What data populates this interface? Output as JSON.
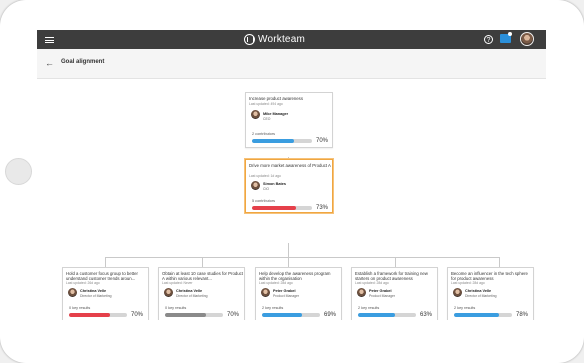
{
  "app": {
    "name": "Workteam"
  },
  "topbar": {
    "help_glyph": "?"
  },
  "page": {
    "title": "Goal alignment",
    "back_glyph": "←"
  },
  "icons": [
    "menu-icon",
    "workteam-logo-icon",
    "help-icon",
    "notifications-icon",
    "user-avatar",
    "back-arrow-icon"
  ],
  "colors": {
    "topbar": "#3d3d3d",
    "blue": "#3a9de0",
    "red": "#e5404a",
    "gray": "#8a8a8a",
    "selected_border": "#f0a640"
  },
  "goals": {
    "root": {
      "title": "Increase product awareness",
      "updated": "Last updated: 494 ago",
      "owner": "Mike Manager",
      "role": "CEO",
      "sub": "2 contributors",
      "progress": 70,
      "pct": "70%",
      "color": "#3a9de0"
    },
    "mid": {
      "title": "Drive more market awareness of Product A",
      "updated": "Last updated: 1d ago",
      "owner": "Simon Bates",
      "role": "CIO",
      "sub": "5 contributors",
      "progress": 73,
      "pct": "73%",
      "color": "#e5404a"
    },
    "children": [
      {
        "title": "Hold a customer focus group to better understand customer trends aroun...",
        "updated": "Last updated: 26d ago",
        "owner": "Christina Velle",
        "role": "Director of Marketing",
        "sub": "0 key results",
        "progress": 70,
        "pct": "70%",
        "color": "#e5404a"
      },
      {
        "title": "Obtain at least 10 case studies for Product A within various relevant...",
        "updated": "Last updated: Never",
        "owner": "Christina Velle",
        "role": "Director of Marketing",
        "sub": "0 key results",
        "progress": 70,
        "pct": "70%",
        "color": "#8a8a8a"
      },
      {
        "title": "Help develop the awareness program within the organisation",
        "updated": "Last updated: 28d ago",
        "owner": "Peter Grabel",
        "role": "Product Manager",
        "sub": "2 key results",
        "progress": 69,
        "pct": "69%",
        "color": "#3a9de0"
      },
      {
        "title": "Establish a framework for training new starters on product awareness",
        "updated": "Last updated: 28d ago",
        "owner": "Peter Grabel",
        "role": "Product Manager",
        "sub": "2 key results",
        "progress": 63,
        "pct": "63%",
        "color": "#3a9de0"
      },
      {
        "title": "Become an influencer in the tech sphere for product awareness",
        "updated": "Last updated: 28d ago",
        "owner": "Christina Velle",
        "role": "Director of Marketing",
        "sub": "2 key results",
        "progress": 78,
        "pct": "78%",
        "color": "#3a9de0"
      }
    ]
  }
}
